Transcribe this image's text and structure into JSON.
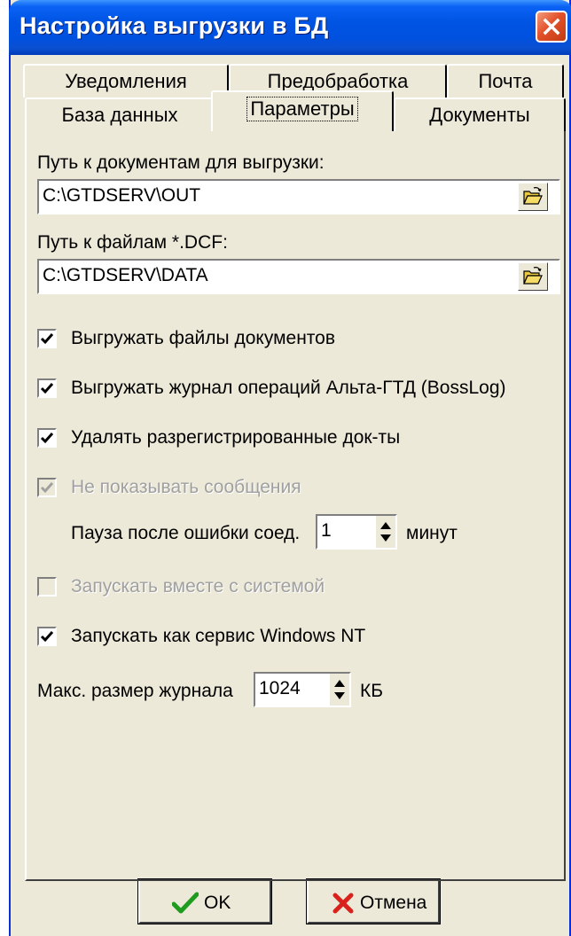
{
  "window": {
    "title": "Настройка выгрузки в БД"
  },
  "tabs": {
    "row_back": [
      {
        "label": "Уведомления"
      },
      {
        "label": "Предобработка"
      },
      {
        "label": "Почта"
      }
    ],
    "row_front": [
      {
        "label": "База данных"
      },
      {
        "label": "Параметры",
        "active": true
      },
      {
        "label": "Документы"
      }
    ]
  },
  "paths": {
    "docs_label": "Путь к документам для выгрузки:",
    "docs_value": "C:\\GTDSERV\\OUT",
    "dcf_label": "Путь к файлам *.DCF:",
    "dcf_value": "C:\\GTDSERV\\DATA"
  },
  "options": [
    {
      "label": "Выгружать файлы документов",
      "checked": true,
      "enabled": true
    },
    {
      "label": "Выгружать журнал операций Альта-ГТД (BossLog)",
      "checked": true,
      "enabled": true
    },
    {
      "label": "Удалять разрегистрированные док-ты",
      "checked": true,
      "enabled": true
    },
    {
      "label": "Не показывать сообщения",
      "checked": true,
      "enabled": false
    },
    {
      "label": "Запускать вместе с системой",
      "checked": false,
      "enabled": false
    },
    {
      "label": "Запускать как сервис Windows NT",
      "checked": true,
      "enabled": true
    }
  ],
  "pause": {
    "label": "Пауза после ошибки соед.",
    "value": "1",
    "unit": "минут"
  },
  "log_size": {
    "label": "Макс. размер журнала",
    "value": "1024",
    "unit": "КБ"
  },
  "buttons": {
    "ok": "OK",
    "cancel": "Отмена"
  },
  "icons": {
    "close": "close-icon",
    "browse": "open-folder-icon",
    "ok": "checkmark-icon",
    "cancel": "red-x-icon",
    "spin": "spin-arrows-icon"
  },
  "colors": {
    "titlebar": "#0054e3",
    "face": "#ece9d8",
    "close": "#e2512a",
    "ok_check": "#1f9c1f",
    "cancel_x": "#d8221b"
  }
}
